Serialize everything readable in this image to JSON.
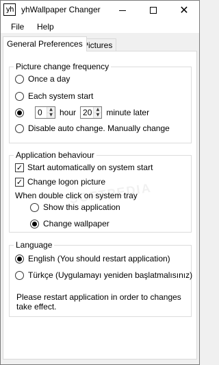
{
  "window": {
    "icon_text": "yh",
    "title": "yhWallpaper Changer",
    "controls": {
      "minimize": "minimize-icon",
      "maximize": "maximize-icon",
      "close": "close-icon"
    }
  },
  "menu": {
    "file": "File",
    "help": "Help"
  },
  "tabs": {
    "general": "General Preferences",
    "pictures": "Pictures",
    "active": "General Preferences"
  },
  "frequency": {
    "label": "Picture change frequency",
    "once_a_day": "Once a day",
    "each_start": "Each system start",
    "hours_value": "0",
    "hour_label": "hour",
    "minutes_value": "20",
    "minute_label": "minute later",
    "disable": "Disable auto change. Manually change",
    "selected": "interval"
  },
  "behaviour": {
    "label": "Application behaviour",
    "start_auto": "Start automatically on system start",
    "start_auto_checked": true,
    "change_logon": "Change logon picture",
    "change_logon_checked": true,
    "tray_label": "When double click on system tray",
    "show_app": "Show this application",
    "change_wallpaper": "Change wallpaper",
    "tray_selected": "change_wallpaper"
  },
  "language": {
    "label": "Language",
    "english": "English (You should restart application)",
    "turkish": "Türkçe (Uygulamayı yeniden başlatmalısınız)",
    "selected": "english",
    "note": "Please restart application in order to changes take effect."
  },
  "watermark": "SOFTPEDIA"
}
